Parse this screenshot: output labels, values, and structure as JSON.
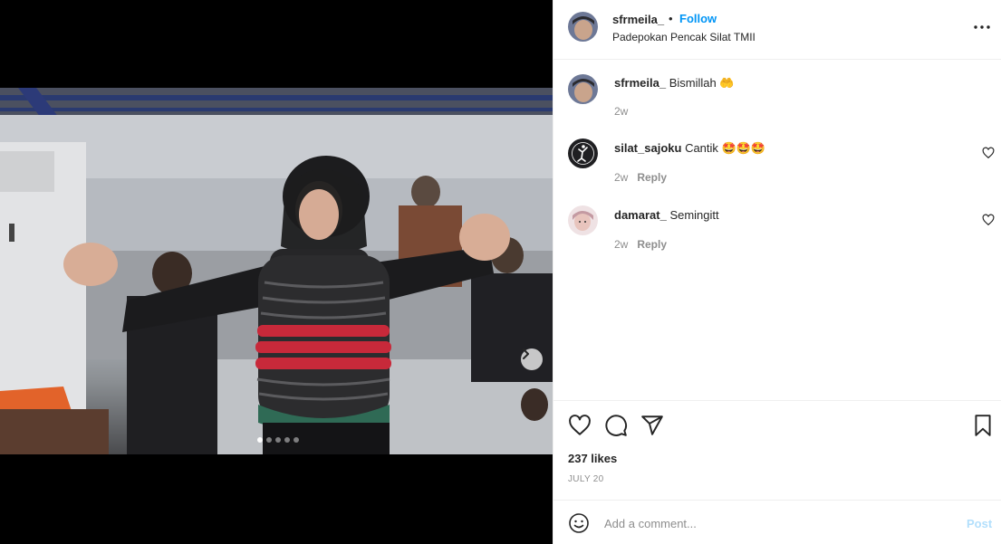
{
  "post": {
    "username": "sfrmeila_",
    "separator": "•",
    "follow_label": "Follow",
    "location": "Padepokan Pencak Silat TMII",
    "more_icon": "more-horizontal-icon"
  },
  "media": {
    "next_icon": "chevron-right-icon",
    "carousel_count": 5,
    "carousel_active": 1
  },
  "comments": [
    {
      "username": "sfrmeila_",
      "text": "Bismillah 🤲",
      "time": "2w",
      "reply_label": ""
    },
    {
      "username": "silat_sajoku",
      "text": "Cantik 🤩🤩🤩",
      "time": "2w",
      "reply_label": "Reply"
    },
    {
      "username": "damarat_",
      "text": "Semingitt",
      "time": "2w",
      "reply_label": "Reply"
    }
  ],
  "actions": {
    "likes": "237 likes",
    "date": "JULY 20"
  },
  "add_comment": {
    "placeholder": "Add a comment...",
    "post_label": "Post"
  },
  "colors": {
    "accent": "#0095f6",
    "muted": "#8e8e8e",
    "post_disabled": "#b2dffc"
  }
}
